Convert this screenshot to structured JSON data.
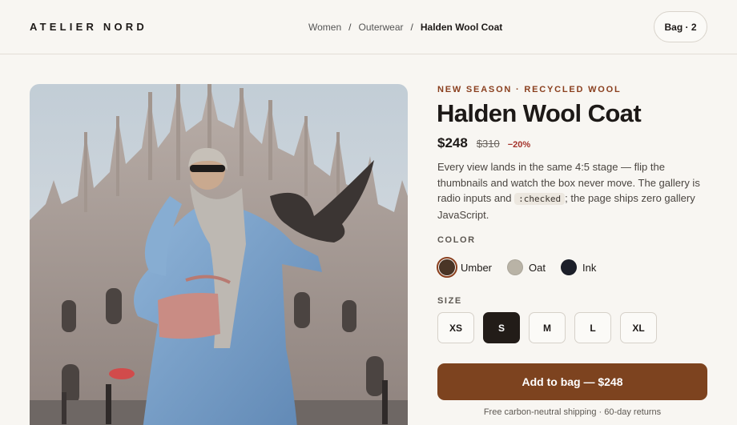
{
  "header": {
    "brand": "ATELIER NORD",
    "breadcrumb": [
      {
        "label": "Women"
      },
      {
        "label": "Outerwear"
      },
      {
        "label": "Halden Wool Coat"
      }
    ],
    "separator": "/",
    "bag_label": "Bag · 2"
  },
  "product": {
    "eyebrow": "NEW SEASON · RECYCLED WOOL",
    "title": "Halden Wool Coat",
    "price": "$248",
    "old_price": "$310",
    "discount": "−20%",
    "description_before": "Every view lands in the same 4:5 stage — flip the thumbnails and watch the box never move. The gallery is radio inputs and ",
    "description_code": ":checked",
    "description_after": "; the page ships zero gallery JavaScript.",
    "image_icon": "photo-coat-model"
  },
  "color": {
    "label": "COLOR",
    "options": [
      {
        "name": "Umber",
        "hex": "#4a3526",
        "selected": true
      },
      {
        "name": "Oat",
        "hex": "#b9b3a6",
        "selected": false
      },
      {
        "name": "Ink",
        "hex": "#1c1f2a",
        "selected": false
      }
    ]
  },
  "size": {
    "label": "SIZE",
    "options": [
      {
        "name": "XS",
        "selected": false
      },
      {
        "name": "S",
        "selected": true
      },
      {
        "name": "M",
        "selected": false
      },
      {
        "name": "L",
        "selected": false
      },
      {
        "name": "XL",
        "selected": false
      }
    ]
  },
  "cta": {
    "label": "Add to bag — $248"
  },
  "shipping_note": "Free carbon-neutral shipping · 60-day returns",
  "colors": {
    "accent": "#8a3f1e",
    "cta_bg": "#7d431f",
    "background": "#f8f6f2"
  }
}
